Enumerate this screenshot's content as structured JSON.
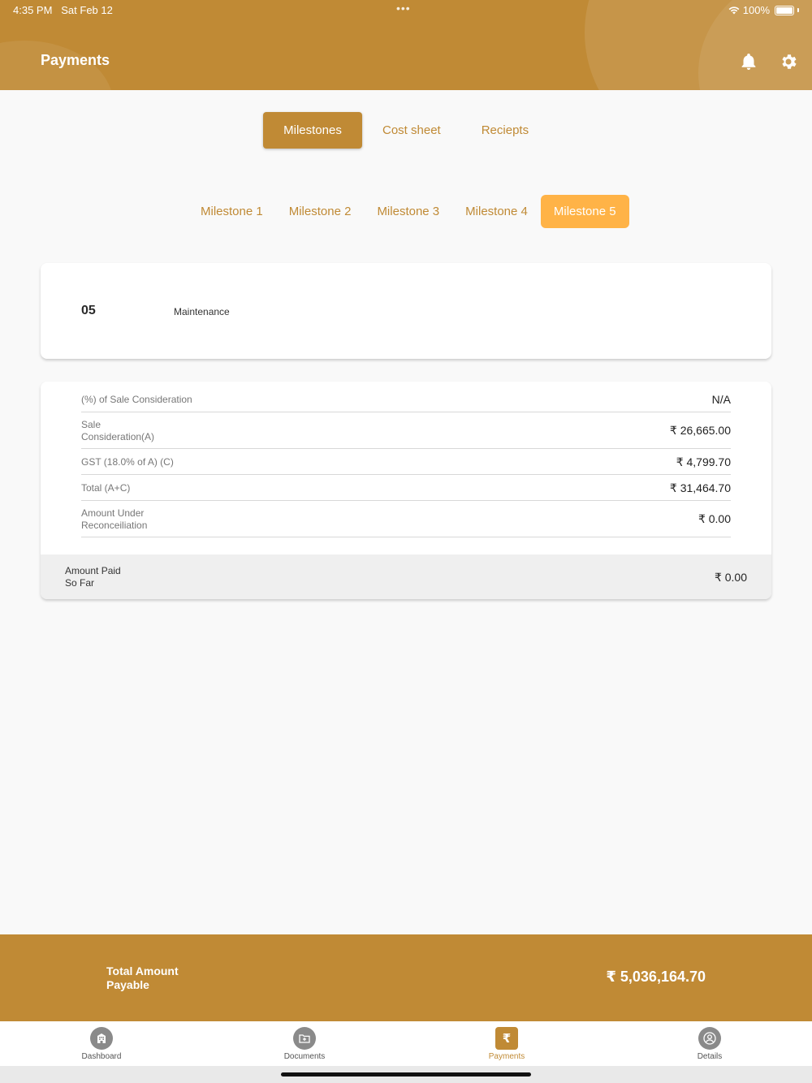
{
  "status_bar": {
    "time": "4:35 PM",
    "date": "Sat Feb 12",
    "dots": "•••",
    "battery": "100%"
  },
  "header": {
    "title": "Payments"
  },
  "colors": {
    "brand": "#c08a35",
    "accent": "#ffb347"
  },
  "icons": {
    "notifications": "bell-icon",
    "settings": "gear-icon",
    "wifi": "wifi-icon"
  },
  "top_tabs": [
    {
      "label": "Milestones",
      "active": true
    },
    {
      "label": "Cost sheet",
      "active": false
    },
    {
      "label": "Reciepts",
      "active": false
    }
  ],
  "milestone_tabs": [
    {
      "label": "Milestone 1",
      "active": false
    },
    {
      "label": "Milestone 2",
      "active": false
    },
    {
      "label": "Milestone 3",
      "active": false
    },
    {
      "label": "Milestone 4",
      "active": false
    },
    {
      "label": "Milestone 5",
      "active": true
    }
  ],
  "milestone": {
    "number": "05",
    "name": "Maintenance"
  },
  "details": {
    "sale_pct_label": "(%) of Sale Consideration",
    "sale_pct_value": "N/A",
    "sale_consideration_label_1": "Sale",
    "sale_consideration_label_2": "Consideration(A)",
    "sale_consideration_value": "₹ 26,665.00",
    "gst_label": "GST (18.0% of A) (C)",
    "gst_value": "₹ 4,799.70",
    "total_label": "Total (A+C)",
    "total_value": "₹ 31,464.70",
    "reconciliation_label_1": "Amount Under",
    "reconciliation_label_2": "Reconceiliation",
    "reconciliation_value": "₹ 0.00",
    "paid_label_1": "Amount Paid",
    "paid_label_2": "So Far",
    "paid_value": "₹ 0.00"
  },
  "total_payable": {
    "label_1": "Total Amount",
    "label_2": "Payable",
    "value": "₹ 5,036,164.70"
  },
  "bottom_nav": [
    {
      "label": "Dashboard",
      "icon": "building-icon",
      "active": false
    },
    {
      "label": "Documents",
      "icon": "folder-icon",
      "active": false
    },
    {
      "label": "Payments",
      "icon": "rupee-icon",
      "active": true
    },
    {
      "label": "Details",
      "icon": "user-icon",
      "active": false
    }
  ],
  "rupee_glyph": "₹"
}
